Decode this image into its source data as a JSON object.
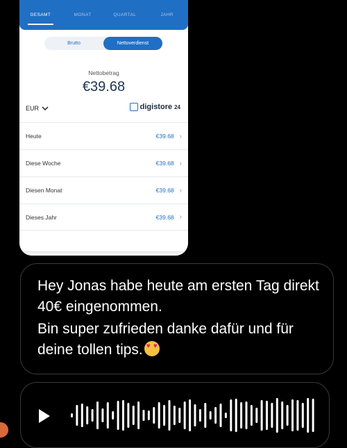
{
  "dashboard": {
    "tabs": [
      "GESAMT",
      "MONAT",
      "QUARTAL",
      "JAHR"
    ],
    "active_tab": "GESAMT",
    "toggle": {
      "left": "Brutto",
      "right": "Nettoverdienst",
      "selected": "Nettoverdienst"
    },
    "net_label": "Nettobetrag",
    "net_value": "€39.68",
    "currency": "EUR",
    "logo": {
      "name": "digistore",
      "suffix": "24"
    },
    "rows": [
      {
        "label": "Heute",
        "amount": "€39.68"
      },
      {
        "label": "Diese Woche",
        "amount": "€39.68"
      },
      {
        "label": "Diesen Monat",
        "amount": "€39.68"
      },
      {
        "label": "Dieses Jahr",
        "amount": "€39.68"
      }
    ]
  },
  "message": {
    "line1": "Hey Jonas habe heute am ersten Tag direkt 40€ eingenommen.",
    "line2": "Bin super zufrieden danke dafür und für deine tollen tips.",
    "emoji": "smiling-face-with-heart-eyes"
  },
  "voice_message": {
    "icon": "play-icon",
    "waveform_bars": 48
  },
  "colors": {
    "accent": "#1f6fc4",
    "background": "#000000",
    "bubble_border": "#3a3a3a"
  }
}
